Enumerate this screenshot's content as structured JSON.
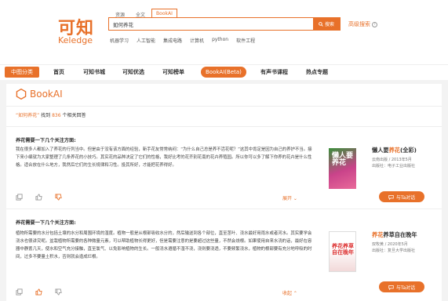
{
  "brand": {
    "cn": "可知",
    "en": "Keledge"
  },
  "search": {
    "tabs": [
      "资源",
      "全文",
      "BookAI"
    ],
    "query": "如何养花",
    "button": "搜索",
    "advanced": "高级搜索",
    "help_icon": "?"
  },
  "hot_keywords": [
    "机器学习",
    "人工智能",
    "集成电路",
    "计算机",
    "python",
    "软件工程"
  ],
  "nav": [
    "中图分类",
    "首页",
    "可知书城",
    "可知优选",
    "可知榜单",
    "BookAI(Beta)",
    "有声书课程",
    "热点专题"
  ],
  "bookai_title": "BookAI",
  "found": {
    "q": "“如何养花”",
    "pre": "找到",
    "count": "836",
    "post": "个相关回答"
  },
  "results": [
    {
      "question": "养花需要一下几个关注方面:",
      "answer": "我在很多人都加入了养花的行列当中。但是由于没有该方面的经验，新手花友常常纳闷：“为什么自己总是养不活花呢？”这其中肯定是因为自己的养护不当。接下来小编就为大家整理了几条养花的小技巧。其实花的品种决定了它们的性格，我好比考的花齐别花南的花卉养殖园。所以你可以多了解下你养的花卉是什么性格。适合放在什么地方，我然后它们的生长规律和习性。投其所好，才能把花养得好。",
      "more": "展开",
      "book": {
        "title_pre": "懒人要",
        "title_hl": "养花",
        "title_post": "(全彩)",
        "publisher": "云南出版  /  2013年5月",
        "source": "出版社：电子工业出版社",
        "cover_text": "懒人要养花"
      }
    },
    {
      "question": "养花需要一下几个关注方面:",
      "answer": "植物所需要的水分包括土壤的水分和周围环境的湿度。植物一般是从根部吸收水分的，然后输送到各个部位，直至茎叶、浇水最好用雨水或者河水。其实要学会浇水也很讲究呢。盆栽植物所需要的各种微量元素，可以帮助植物长得更好，但是需要注意的是要超过这些量，不然会烧根。如果使用自来水浇的话，最好在容器中静置几天，使水和空气充分接触，直至氯气、以免影响植物的生长。一般浇水遵循不湿不浇，浇则要浇透，不要频繁浇水，植物的根部要有充分地呼吸的时间，过多不要量土积水，否则就会造成烂根。",
      "more": "收起",
      "book": {
        "title_pre": "",
        "title_hl": "养花",
        "title_post": "养草自在晚年",
        "publisher": "双牧黄  /  2020年5月",
        "source": "出版社：复旦大学出版社",
        "cover_text": "养花养草自在晚年"
      }
    }
  ],
  "ta_button": "与Ta对话",
  "colors": {
    "accent": "#e8712a"
  }
}
